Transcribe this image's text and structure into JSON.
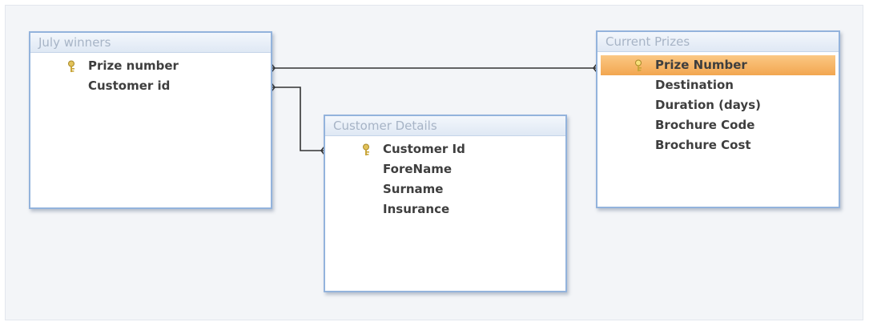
{
  "tables": [
    {
      "id": "july-winners",
      "title": "July winners",
      "fields": [
        {
          "label": "Prize number",
          "key": true
        },
        {
          "label": "Customer id",
          "key": false
        }
      ]
    },
    {
      "id": "customer-details",
      "title": "Customer Details",
      "fields": [
        {
          "label": "Customer Id",
          "key": true
        },
        {
          "label": "ForeName",
          "key": false
        },
        {
          "label": "Surname",
          "key": false
        },
        {
          "label": "Insurance",
          "key": false
        }
      ]
    },
    {
      "id": "current-prizes",
      "title": "Current Prizes",
      "fields": [
        {
          "label": "Prize Number",
          "key": true,
          "selected": true
        },
        {
          "label": "Destination",
          "key": false
        },
        {
          "label": "Duration (days)",
          "key": false
        },
        {
          "label": "Brochure Code",
          "key": false
        },
        {
          "label": "Brochure Cost",
          "key": false
        }
      ]
    }
  ],
  "relationships": [
    {
      "from": "July winners.Prize number",
      "to": "Current Prizes.Prize Number"
    },
    {
      "from": "July winners.Customer id",
      "to": "Customer Details.Customer Id"
    }
  ],
  "colors": {
    "border": "#93b3dc",
    "title_text": "#a7b4c6",
    "selected": "#f2a650",
    "line": "#333333",
    "key_icon": "#e2c25a"
  },
  "icons": {
    "primary_key": "key-icon"
  }
}
